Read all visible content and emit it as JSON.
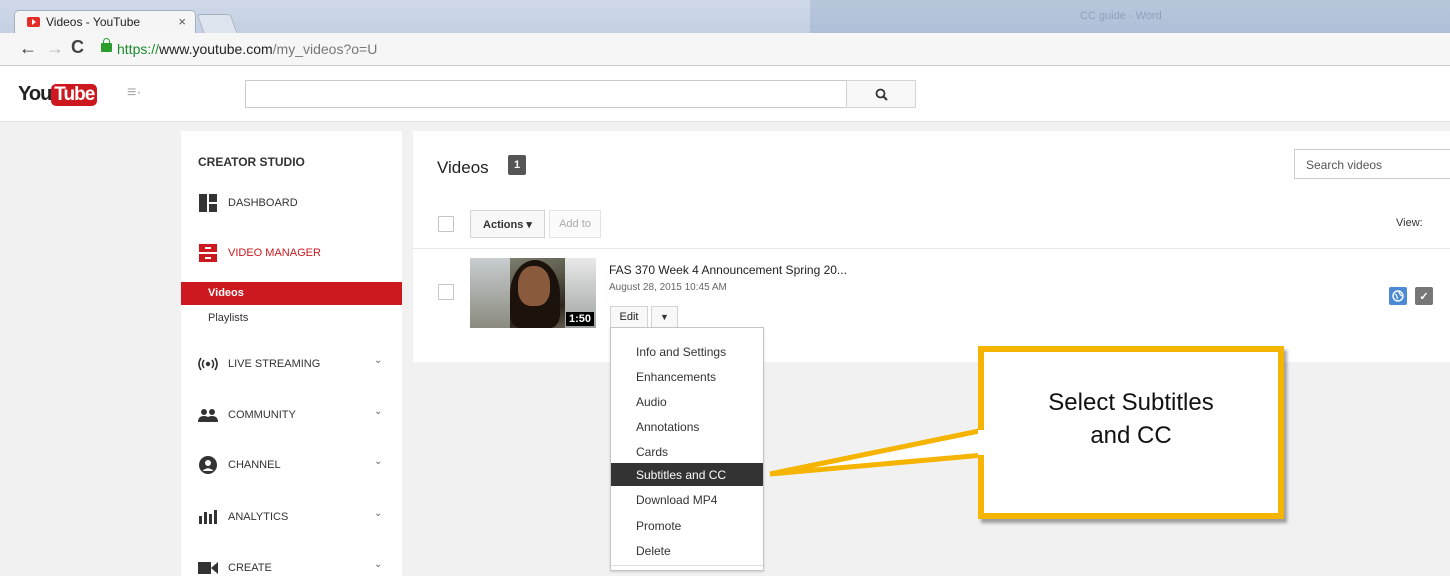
{
  "browser": {
    "tab_title": "Videos - YouTube",
    "tab_close": "×",
    "ghost_title": "CC guide - Word",
    "url_scheme": "https://",
    "url_host": "www.youtube.com",
    "url_path": "/my_videos?o=U",
    "back": "←",
    "forward": "→",
    "reload": "C"
  },
  "masthead": {
    "logo_you": "You",
    "logo_tube": "Tube",
    "guide": "≡·"
  },
  "sidebar": {
    "title": "CREATOR STUDIO",
    "items": [
      {
        "label": "DASHBOARD",
        "icon": "dashboard-icon"
      },
      {
        "label": "VIDEO MANAGER",
        "icon": "video-manager-icon"
      },
      {
        "label": "LIVE STREAMING",
        "icon": "live-streaming-icon"
      },
      {
        "label": "COMMUNITY",
        "icon": "community-icon"
      },
      {
        "label": "CHANNEL",
        "icon": "channel-icon"
      },
      {
        "label": "ANALYTICS",
        "icon": "analytics-icon"
      },
      {
        "label": "CREATE",
        "icon": "create-icon"
      }
    ],
    "sub_items": [
      "Videos",
      "Playlists"
    ],
    "chevron": "⌄"
  },
  "main": {
    "title": "Videos",
    "count": "1",
    "search_placeholder": "Search videos",
    "actions_label": "Actions ▾",
    "add_to_label": "Add to",
    "view_label": "View:",
    "video": {
      "title": "FAS 370 Week 4 Announcement Spring 20...",
      "date": "August 28, 2015 10:45 AM",
      "duration": "1:50",
      "edit_label": "Edit",
      "caret": "▼",
      "check": "✓"
    }
  },
  "menu": {
    "items": [
      "Info and Settings",
      "Enhancements",
      "Audio",
      "Annotations",
      "Cards",
      "Subtitles and CC",
      "Download MP4",
      "Promote",
      "Delete"
    ],
    "selected": "Subtitles and CC"
  },
  "callout": {
    "line1": "Select Subtitles",
    "line2": "and CC"
  },
  "colors": {
    "brand_red": "#cc181e",
    "callout_border": "#f4b400",
    "menu_selected_bg": "#333333",
    "public_blue": "#4a8bd4"
  }
}
